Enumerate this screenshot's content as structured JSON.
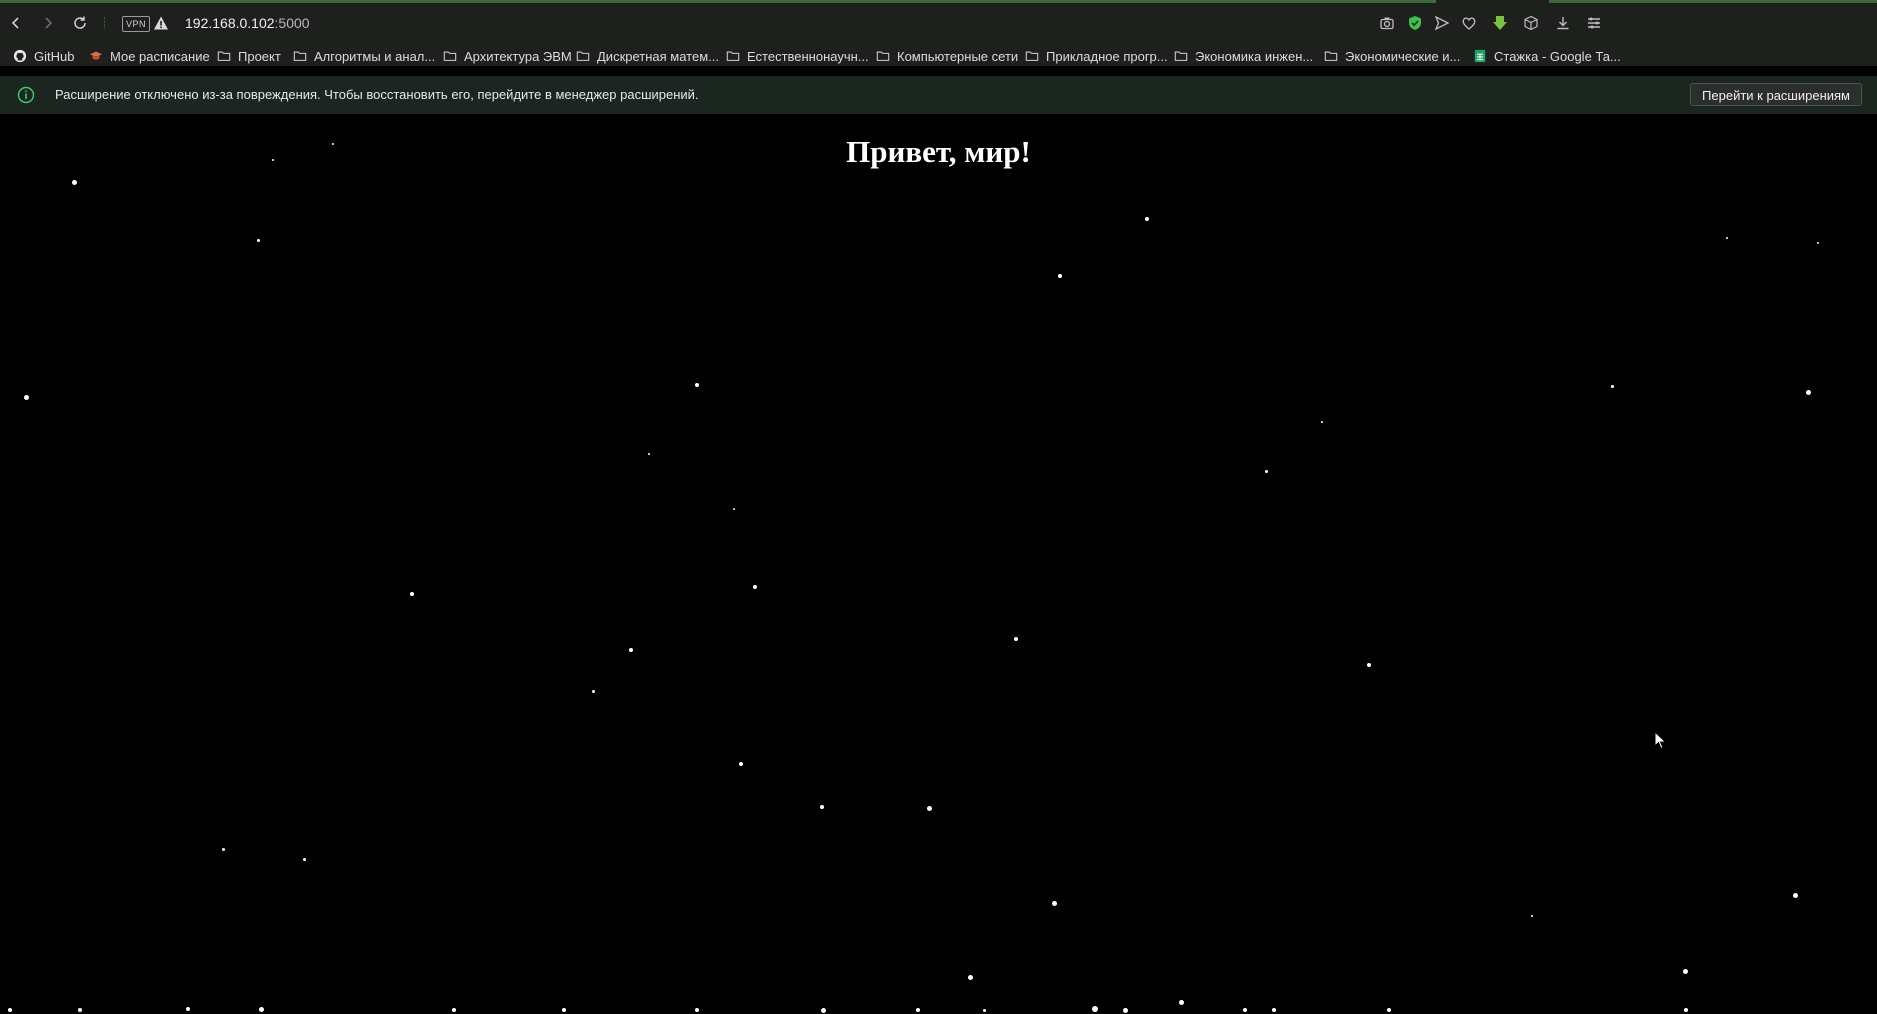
{
  "browser": {
    "vpn_label": "VPN",
    "url_host": "192.168.0.102",
    "url_port": ":5000"
  },
  "bookmarks": [
    {
      "label": "GitHub",
      "icon": "github-icon"
    },
    {
      "label": "Мое расписание",
      "icon": "schedule-hat-icon"
    },
    {
      "label": "Проект",
      "icon": "folder-icon"
    },
    {
      "label": "Алгоритмы и анал...",
      "icon": "folder-icon"
    },
    {
      "label": "Архитектура ЭВМ",
      "icon": "folder-icon"
    },
    {
      "label": "Дискретная матем...",
      "icon": "folder-icon"
    },
    {
      "label": "Естественнонаучн...",
      "icon": "folder-icon"
    },
    {
      "label": "Компьютерные сети",
      "icon": "folder-icon"
    },
    {
      "label": "Прикладное прогр...",
      "icon": "folder-icon"
    },
    {
      "label": "Экономика инжен...",
      "icon": "folder-icon"
    },
    {
      "label": "Экономические и...",
      "icon": "folder-icon"
    },
    {
      "label": "Стажка - Google Та...",
      "icon": "google-sheets-icon"
    }
  ],
  "infobar": {
    "message": "Расширение отключено из-за повреждения. Чтобы восстановить его, перейдите в менеджер расширений.",
    "button_label": "Перейти к расширениям"
  },
  "page": {
    "heading": "Привет, мир!"
  },
  "colors": {
    "background": "#000000",
    "star": "#ffffff",
    "accent_green": "#3a6b3a"
  }
}
